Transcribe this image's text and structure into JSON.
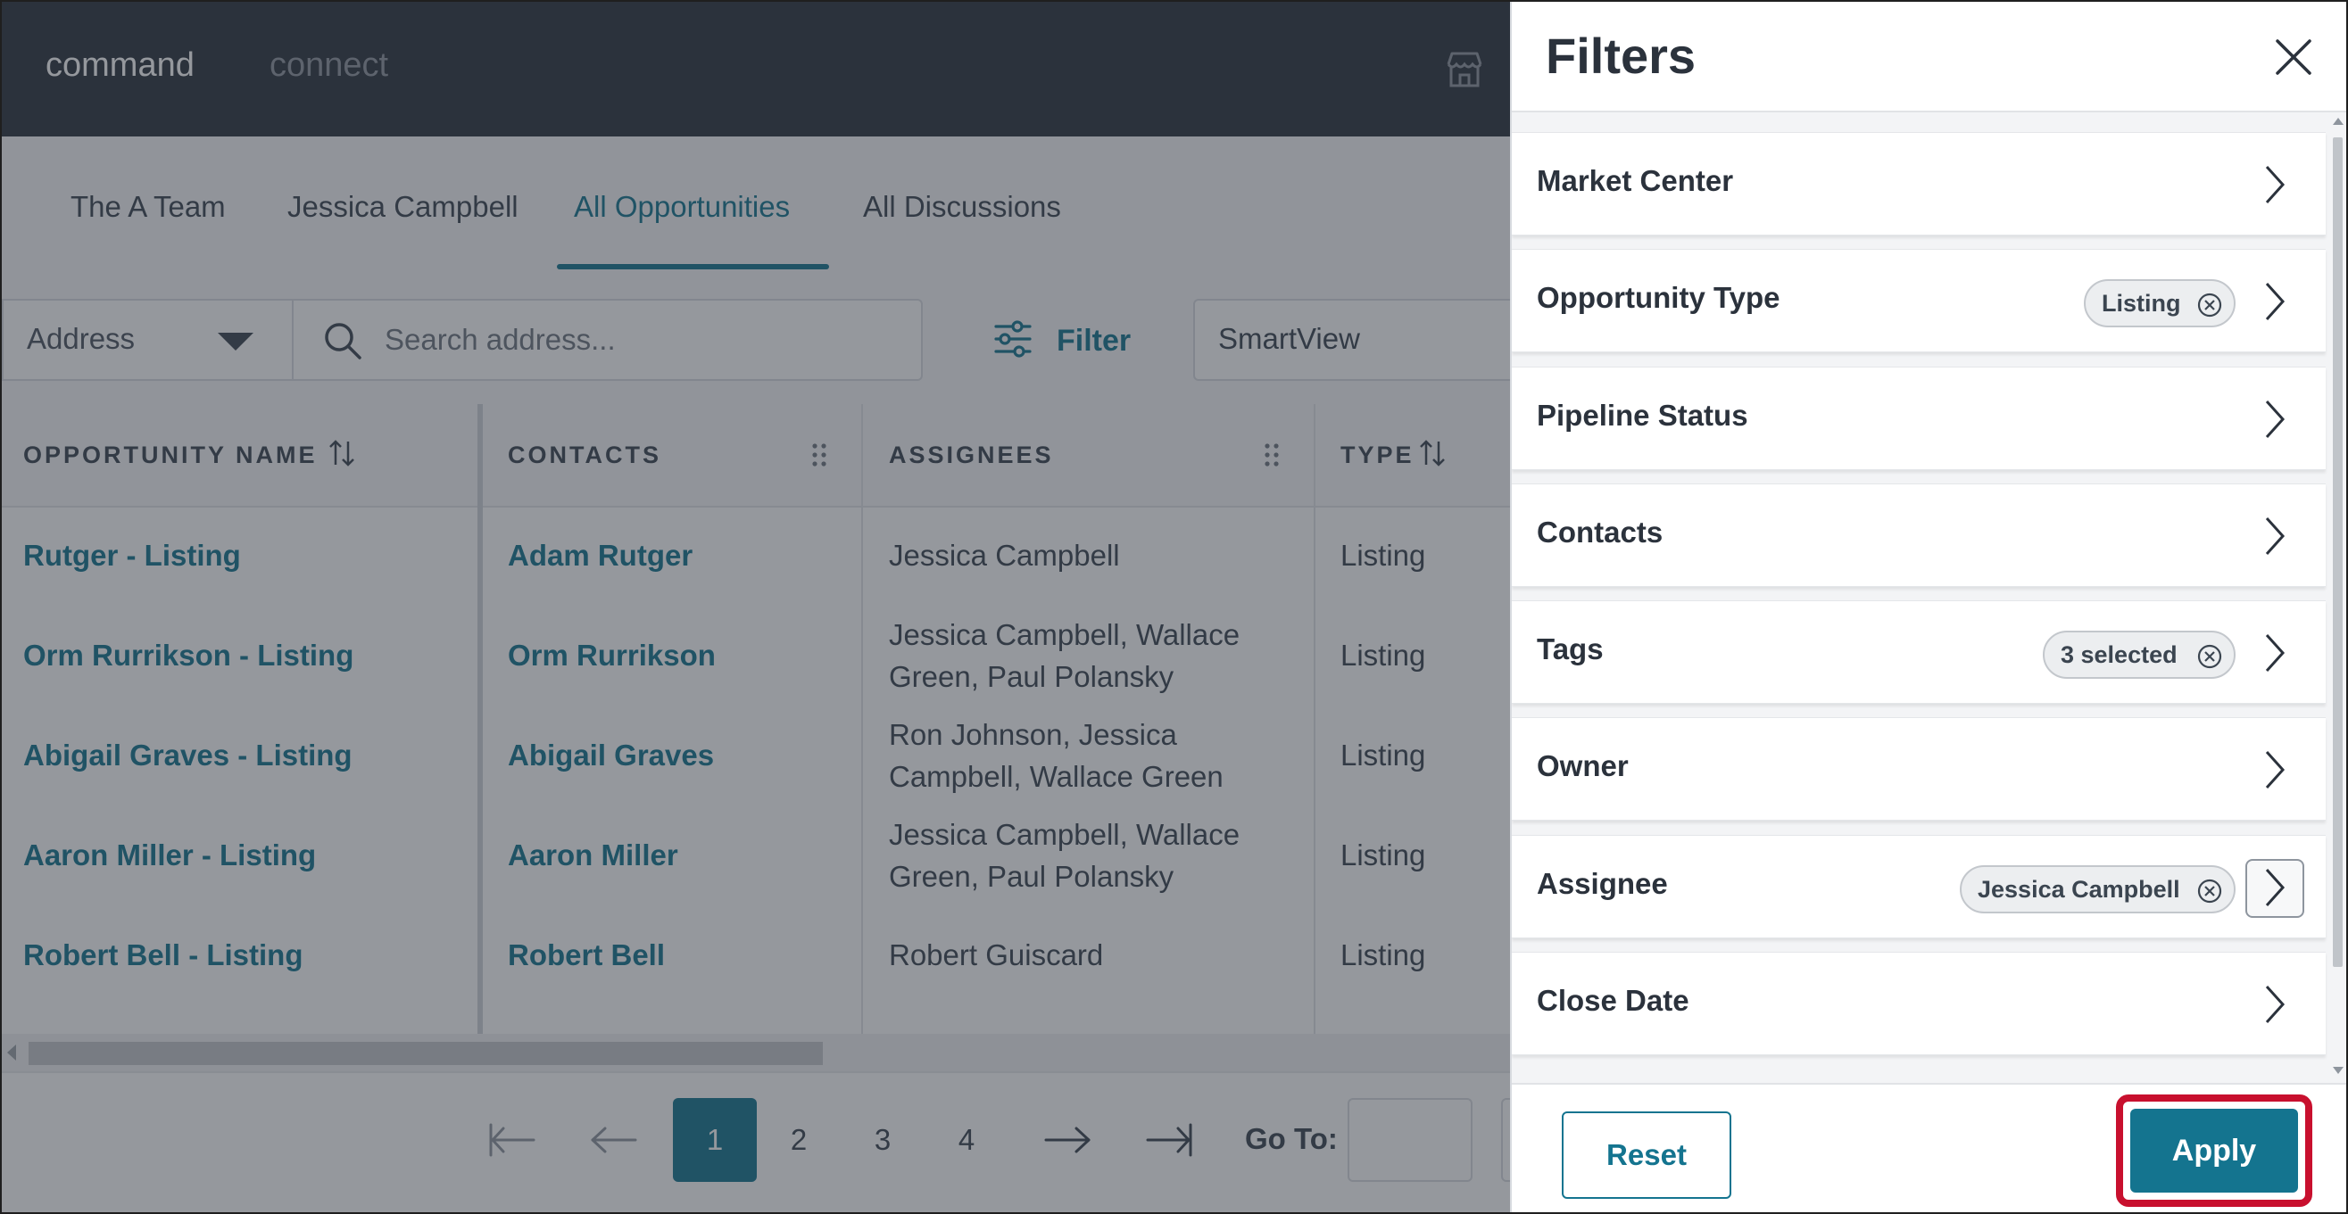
{
  "app": {
    "brand_primary": "command",
    "brand_secondary": "connect",
    "store_icon": "storefront-icon"
  },
  "tabs": [
    {
      "label": "The A Team"
    },
    {
      "label": "Jessica Campbell"
    },
    {
      "label": "All Opportunities",
      "active": true
    },
    {
      "label": "All Discussions"
    }
  ],
  "toolbar": {
    "address_select": "Address",
    "search_placeholder": "Search address...",
    "filter_label": "Filter",
    "smartview_label": "SmartView"
  },
  "table": {
    "headers": [
      "OPPORTUNITY NAME",
      "CONTACTS",
      "ASSIGNEES",
      "TYPE"
    ],
    "rows": [
      {
        "name": "Rutger - Listing",
        "contact": "Adam Rutger",
        "assignees": "Jessica Campbell",
        "type": "Listing"
      },
      {
        "name": "Orm Rurrikson - Listing",
        "contact": "Orm Rurrikson",
        "assignees": "Jessica Campbell, Wallace Green, Paul Polansky",
        "type": "Listing"
      },
      {
        "name": "Abigail Graves - Listing",
        "contact": "Abigail Graves",
        "assignees": "Ron Johnson, Jessica Campbell, Wallace Green",
        "type": "Listing"
      },
      {
        "name": "Aaron Miller - Listing",
        "contact": "Aaron Miller",
        "assignees": "Jessica Campbell, Wallace Green, Paul Polansky",
        "type": "Listing"
      },
      {
        "name": "Robert Bell - Listing",
        "contact": "Robert Bell",
        "assignees": "Robert Guiscard",
        "type": "Listing"
      }
    ]
  },
  "pager": {
    "pages": [
      "1",
      "2",
      "3",
      "4"
    ],
    "current": "1",
    "goto_label": "Go To:"
  },
  "filters": {
    "title": "Filters",
    "items": [
      {
        "label": "Market Center"
      },
      {
        "label": "Opportunity Type",
        "chip": "Listing"
      },
      {
        "label": "Pipeline Status"
      },
      {
        "label": "Contacts"
      },
      {
        "label": "Tags",
        "chip": "3 selected"
      },
      {
        "label": "Owner"
      },
      {
        "label": "Assignee",
        "chip": "Jessica Campbell"
      },
      {
        "label": "Close Date"
      }
    ],
    "reset_label": "Reset",
    "apply_label": "Apply"
  },
  "colors": {
    "accent": "#14748f",
    "topbar": "#2b323c",
    "highlight": "#c8102e"
  }
}
